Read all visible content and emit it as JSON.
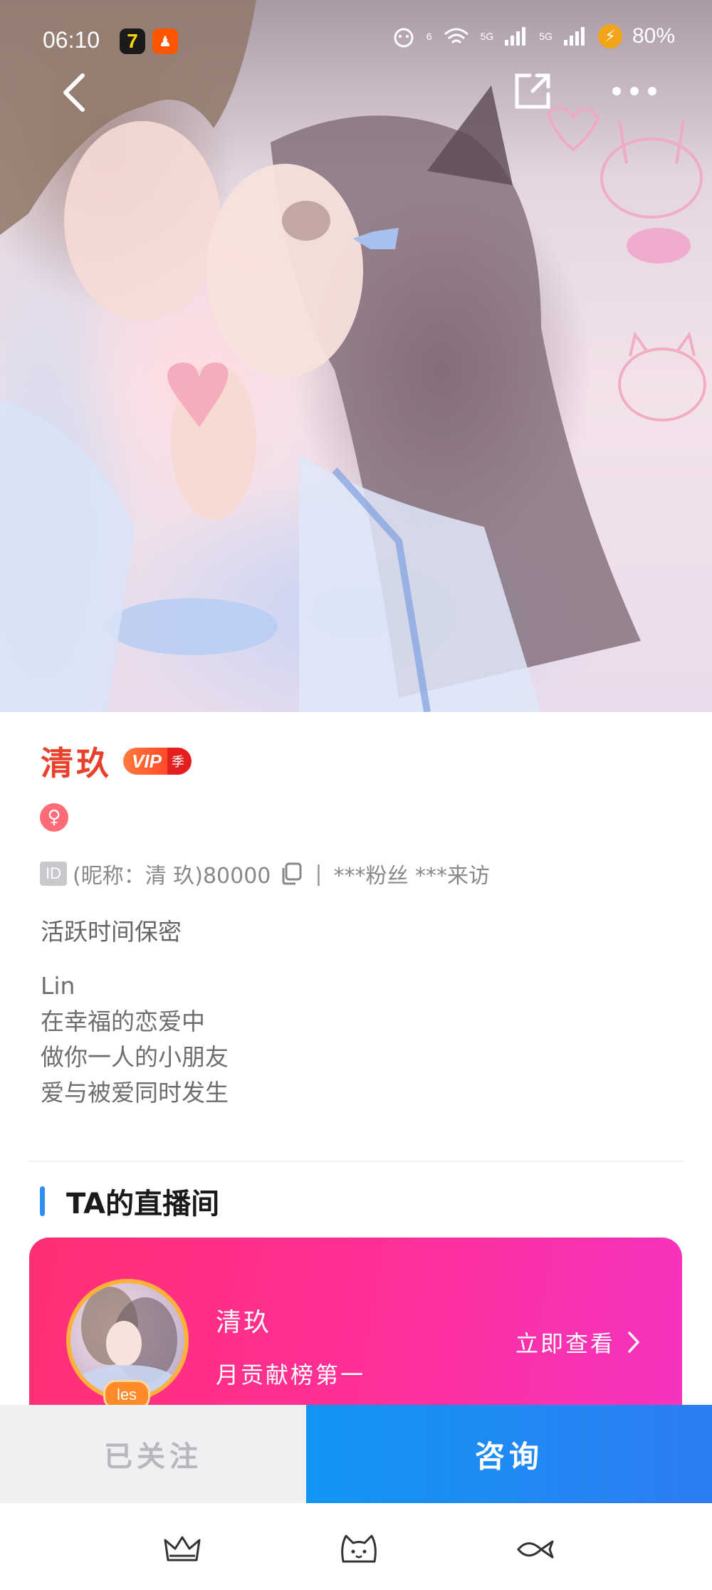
{
  "status_bar": {
    "time": "06:10",
    "app1_glyph": "7",
    "app2_icon": "kuaishou-icon",
    "network_label_1": "5G",
    "network_label_2": "5G",
    "notification_count": "6",
    "battery": "80%"
  },
  "header": {
    "back_icon": "back-arrow-icon",
    "share_icon": "share-icon",
    "more_icon": "more-dots-icon"
  },
  "profile": {
    "name": "清玖",
    "vip_label": "VIP",
    "vip_tag": "季",
    "gender_symbol": "♀",
    "id_badge": "ID",
    "id_text": "(昵称：清 玖)80000",
    "separator": "|",
    "stats_text": "***粉丝 ***来访",
    "active_status": "活跃时间保密",
    "bio_lines": [
      "Lin",
      "在幸福的恋爱中",
      "做你一人的小朋友",
      "爱与被爱同时发生"
    ]
  },
  "live_section": {
    "title": "TA的直播间",
    "card": {
      "name": "清玖",
      "subtitle": "月贡献榜第一",
      "avatar_tag": "les",
      "cta": "立即查看"
    }
  },
  "actions": {
    "followed_label": "已关注",
    "consult_label": "咨询"
  },
  "colors": {
    "name_red": "#e8412b",
    "accent_blue": "#2e8ff5",
    "card_pink": "#ff2f93",
    "consult_blue": "#1296f6"
  }
}
